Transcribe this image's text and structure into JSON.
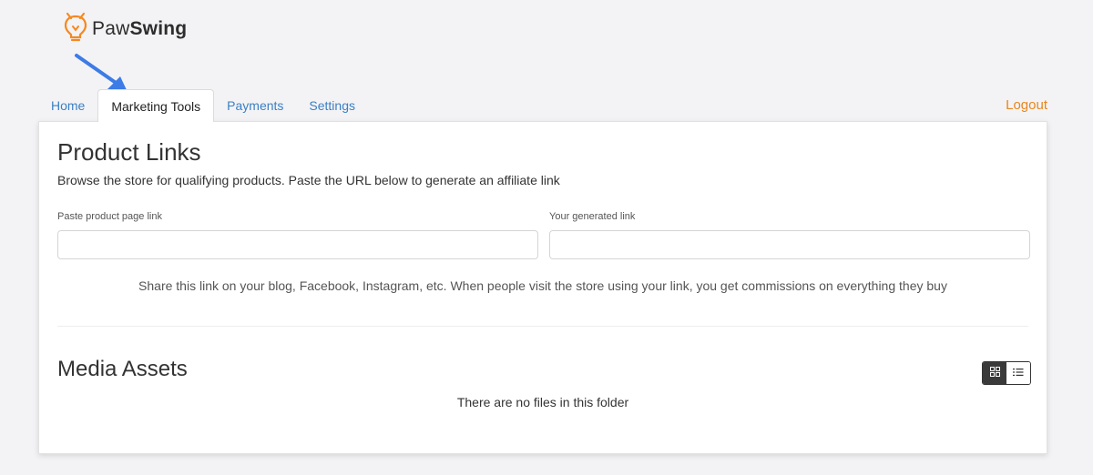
{
  "brand": {
    "name_light": "Paw",
    "name_bold": "Swing",
    "accent_color": "#f5891f"
  },
  "tabs": [
    {
      "label": "Home"
    },
    {
      "label": "Marketing Tools",
      "active": true
    },
    {
      "label": "Payments"
    },
    {
      "label": "Settings"
    }
  ],
  "logout_label": "Logout",
  "product_links": {
    "title": "Product Links",
    "subtitle": "Browse the store for qualifying products. Paste the URL below to generate an affiliate link",
    "paste_label": "Paste product page link",
    "paste_value": "",
    "generated_label": "Your generated link",
    "generated_value": "",
    "share_note": "Share this link on your blog, Facebook, Instagram, etc. When people visit the store using your link, you get commissions on everything they buy"
  },
  "media_assets": {
    "title": "Media Assets",
    "empty_message": "There are no files in this folder",
    "view_modes": [
      "grid-icon",
      "list-icon"
    ],
    "active_view": "grid"
  },
  "colors": {
    "link": "#3b7fc4",
    "logout": "#e8861c",
    "arrow": "#3d7be6"
  }
}
